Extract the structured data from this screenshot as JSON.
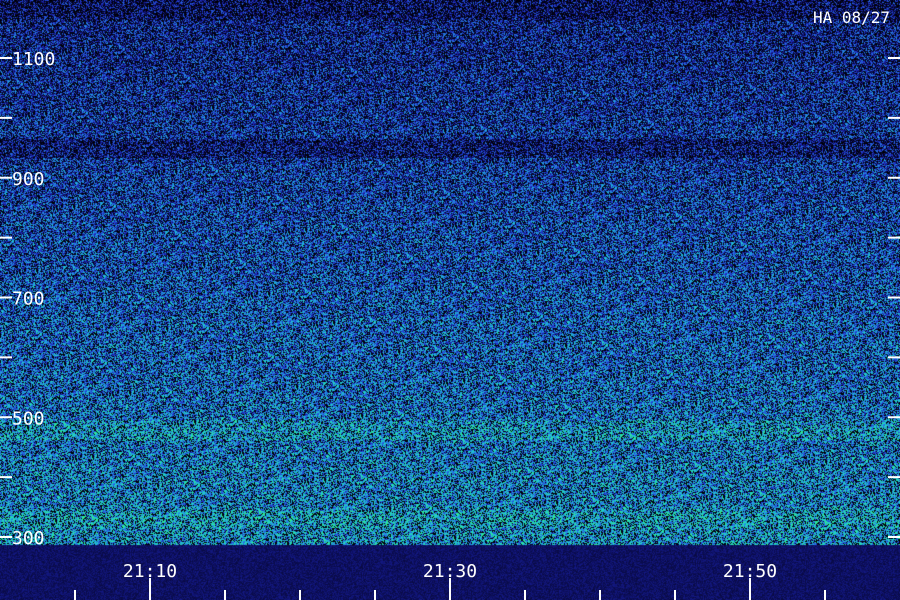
{
  "chart_data": {
    "type": "heatmap",
    "station_label": "HA 08/27",
    "y_axis": {
      "range": [
        300,
        1150
      ],
      "tick_labels": [
        "1100",
        "900",
        "700",
        "500",
        "300"
      ],
      "tick_values": [
        1100,
        900,
        700,
        500,
        300
      ],
      "minor_tick_values": [
        1000,
        800,
        600,
        400
      ]
    },
    "x_axis": {
      "range": [
        "21:02",
        "21:59"
      ],
      "tick_labels": [
        "21:10",
        "21:30",
        "21:50"
      ],
      "tick_values": [
        "21:10",
        "21:30",
        "21:50"
      ],
      "minor_tick_values": [
        "21:05",
        "21:15",
        "21:20",
        "21:25",
        "21:35",
        "21:40",
        "21:45",
        "21:55"
      ]
    },
    "colormap": [
      "#0a0c4a",
      "#1a20b0",
      "#2a60e0",
      "#20a0e0",
      "#20d8c0",
      "#30f080"
    ],
    "grid": false,
    "legend": "none"
  }
}
